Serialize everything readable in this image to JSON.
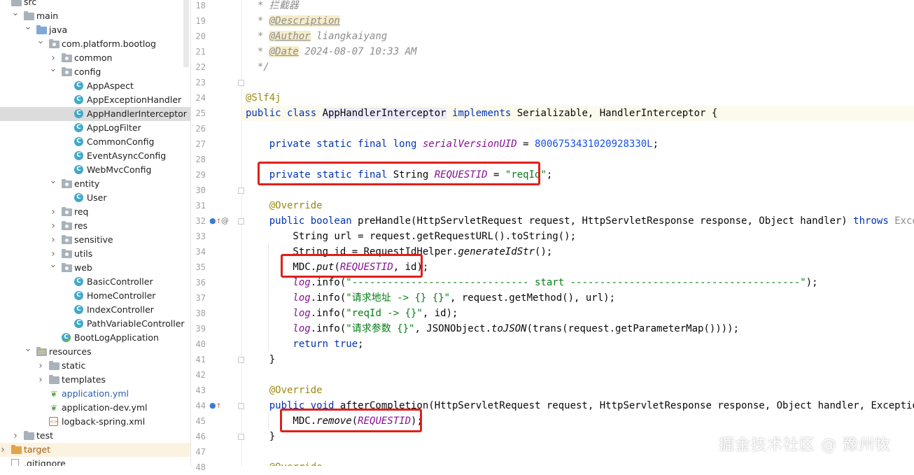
{
  "tree": {
    "items": [
      {
        "label": "src",
        "depth": 0,
        "arrow": "",
        "icon": "folder-icon"
      },
      {
        "label": "main",
        "depth": 1,
        "arrow": "down",
        "icon": "folder-icon"
      },
      {
        "label": "java",
        "depth": 2,
        "arrow": "down",
        "icon": "source-folder-icon"
      },
      {
        "label": "com.platform.bootlog",
        "depth": 3,
        "arrow": "down",
        "icon": "package-icon"
      },
      {
        "label": "common",
        "depth": 4,
        "arrow": "right",
        "icon": "package-icon"
      },
      {
        "label": "config",
        "depth": 4,
        "arrow": "down",
        "icon": "package-icon"
      },
      {
        "label": "AppAspect",
        "depth": 5,
        "arrow": "",
        "icon": "class-icon"
      },
      {
        "label": "AppExceptionHandler",
        "depth": 5,
        "arrow": "",
        "icon": "class-icon"
      },
      {
        "label": "AppHandlerInterceptor",
        "depth": 5,
        "arrow": "",
        "icon": "class-icon",
        "selected": true
      },
      {
        "label": "AppLogFilter",
        "depth": 5,
        "arrow": "",
        "icon": "class-icon"
      },
      {
        "label": "CommonConfig",
        "depth": 5,
        "arrow": "",
        "icon": "class-icon"
      },
      {
        "label": "EventAsyncConfig",
        "depth": 5,
        "arrow": "",
        "icon": "class-icon"
      },
      {
        "label": "WebMvcConfig",
        "depth": 5,
        "arrow": "",
        "icon": "class-icon"
      },
      {
        "label": "entity",
        "depth": 4,
        "arrow": "down",
        "icon": "package-icon"
      },
      {
        "label": "User",
        "depth": 5,
        "arrow": "",
        "icon": "class-icon"
      },
      {
        "label": "req",
        "depth": 4,
        "arrow": "right",
        "icon": "package-icon"
      },
      {
        "label": "res",
        "depth": 4,
        "arrow": "right",
        "icon": "package-icon"
      },
      {
        "label": "sensitive",
        "depth": 4,
        "arrow": "right",
        "icon": "package-icon"
      },
      {
        "label": "utils",
        "depth": 4,
        "arrow": "right",
        "icon": "package-icon"
      },
      {
        "label": "web",
        "depth": 4,
        "arrow": "down",
        "icon": "package-icon"
      },
      {
        "label": "BasicController",
        "depth": 5,
        "arrow": "",
        "icon": "class-icon"
      },
      {
        "label": "HomeController",
        "depth": 5,
        "arrow": "",
        "icon": "class-icon"
      },
      {
        "label": "IndexController",
        "depth": 5,
        "arrow": "",
        "icon": "class-icon"
      },
      {
        "label": "PathVariableController",
        "depth": 5,
        "arrow": "",
        "icon": "class-icon"
      },
      {
        "label": "BootLogApplication",
        "depth": 4,
        "arrow": "",
        "icon": "spring-class-icon"
      },
      {
        "label": "resources",
        "depth": 2,
        "arrow": "down",
        "icon": "resources-folder-icon"
      },
      {
        "label": "static",
        "depth": 3,
        "arrow": "right",
        "icon": "folder-icon"
      },
      {
        "label": "templates",
        "depth": 3,
        "arrow": "right",
        "icon": "folder-icon"
      },
      {
        "label": "application.yml",
        "depth": 3,
        "arrow": "",
        "icon": "yml-icon",
        "color": "blue"
      },
      {
        "label": "application-dev.yml",
        "depth": 3,
        "arrow": "",
        "icon": "yml-icon"
      },
      {
        "label": "logback-spring.xml",
        "depth": 3,
        "arrow": "",
        "icon": "xml-icon"
      },
      {
        "label": "test",
        "depth": 1,
        "arrow": "right",
        "icon": "folder-icon"
      },
      {
        "label": "target",
        "depth": 0,
        "arrow": "right",
        "icon": "excluded-folder-icon",
        "color": "orange",
        "excluded": true
      },
      {
        "label": ".gitignore",
        "depth": 0,
        "arrow": "",
        "icon": "file-icon"
      }
    ]
  },
  "editor": {
    "lines": [
      {
        "n": "18",
        "tokens": [
          [
            "cmt",
            "  * 拦截器"
          ]
        ]
      },
      {
        "n": "19",
        "tokens": [
          [
            "cmt",
            "  * "
          ],
          [
            "tag",
            "@Description"
          ]
        ]
      },
      {
        "n": "20",
        "tokens": [
          [
            "cmt",
            "  * "
          ],
          [
            "tag",
            "@Author"
          ],
          [
            "cmt",
            " liangkaiyang"
          ]
        ]
      },
      {
        "n": "21",
        "tokens": [
          [
            "cmt",
            "  * "
          ],
          [
            "tag",
            "@Date"
          ],
          [
            "cmt",
            " 2024-08-07 10:33 AM"
          ]
        ]
      },
      {
        "n": "22",
        "tokens": [
          [
            "cmt",
            "  */"
          ]
        ]
      },
      {
        "n": "23",
        "tokens": []
      },
      {
        "n": "24",
        "tokens": [
          [
            "ann",
            "@Slf4j"
          ]
        ]
      },
      {
        "n": "25",
        "current": true,
        "tokens": [
          [
            "kw",
            "public class "
          ],
          [
            "cls-hl",
            "AppHandlerInterceptor"
          ],
          [
            "kw",
            " implements "
          ],
          [
            "",
            "Serializable, HandlerInterceptor {"
          ]
        ]
      },
      {
        "n": "26",
        "tokens": []
      },
      {
        "n": "27",
        "tokens": [
          [
            "kw",
            "    private static final long "
          ],
          [
            "const",
            "serialVersionUID"
          ],
          [
            "",
            " = "
          ],
          [
            "num",
            "8006753431020928330L"
          ],
          [
            "",
            ";"
          ]
        ]
      },
      {
        "n": "28",
        "tokens": []
      },
      {
        "n": "29",
        "tokens": [
          [
            "kw",
            "    private static final "
          ],
          [
            "",
            "String "
          ],
          [
            "const",
            "REQUESTID"
          ],
          [
            "",
            " = "
          ],
          [
            "str",
            "\"reqId\""
          ],
          [
            "",
            ";"
          ]
        ]
      },
      {
        "n": "30",
        "tokens": []
      },
      {
        "n": "31",
        "tokens": [
          [
            "ann",
            "    @Override"
          ]
        ]
      },
      {
        "n": "32",
        "tokens": [
          [
            "kw",
            "    public boolean "
          ],
          [
            "",
            "preHandle(HttpServletRequest request, HttpServletResponse response, Object handler) "
          ],
          [
            "kw",
            "throws "
          ],
          [
            "cmt2",
            "Exception"
          ]
        ]
      },
      {
        "n": "33",
        "tokens": [
          [
            "",
            "        String url = request.getRequestURL().toString();"
          ]
        ]
      },
      {
        "n": "34",
        "tokens": [
          [
            "",
            "        String id = RequestIdHelper."
          ],
          [
            "static",
            "generateIdStr"
          ],
          [
            "",
            "();"
          ]
        ]
      },
      {
        "n": "35",
        "tokens": [
          [
            "",
            "        MDC."
          ],
          [
            "static",
            "put"
          ],
          [
            "",
            "("
          ],
          [
            "const",
            "REQUESTID"
          ],
          [
            "",
            ", id);"
          ]
        ]
      },
      {
        "n": "36",
        "tokens": [
          [
            "log",
            "        log"
          ],
          [
            "",
            ".info("
          ],
          [
            "str",
            "\"------------------------------ start ---------------------------------------\""
          ],
          [
            "",
            ");"
          ]
        ]
      },
      {
        "n": "37",
        "tokens": [
          [
            "log",
            "        log"
          ],
          [
            "",
            ".info("
          ],
          [
            "str",
            "\"请求地址 -> {} {}\""
          ],
          [
            "",
            ", request.getMethod(), url);"
          ]
        ]
      },
      {
        "n": "38",
        "tokens": [
          [
            "log",
            "        log"
          ],
          [
            "",
            ".info("
          ],
          [
            "str",
            "\"reqId -> {}\""
          ],
          [
            "",
            ", id);"
          ]
        ]
      },
      {
        "n": "39",
        "tokens": [
          [
            "log",
            "        log"
          ],
          [
            "",
            ".info("
          ],
          [
            "str",
            "\"请求参数 {}\""
          ],
          [
            "",
            ", JSONObject."
          ],
          [
            "static",
            "toJSON"
          ],
          [
            "",
            "(trans(request.getParameterMap())));"
          ]
        ]
      },
      {
        "n": "40",
        "tokens": [
          [
            "kw",
            "        return true"
          ],
          [
            "",
            ";"
          ]
        ]
      },
      {
        "n": "41",
        "tokens": [
          [
            "",
            "    }"
          ]
        ]
      },
      {
        "n": "42",
        "tokens": []
      },
      {
        "n": "43",
        "tokens": [
          [
            "ann",
            "    @Override"
          ]
        ]
      },
      {
        "n": "44",
        "tokens": [
          [
            "kw",
            "    public void "
          ],
          [
            "",
            "afterCompletion(HttpServletRequest request, HttpServletResponse response, Object handler, Exception ex)"
          ]
        ]
      },
      {
        "n": "45",
        "tokens": [
          [
            "",
            "        MDC."
          ],
          [
            "static",
            "remove"
          ],
          [
            "",
            "("
          ],
          [
            "const",
            "REQUESTID"
          ],
          [
            "",
            ");"
          ]
        ]
      },
      {
        "n": "46",
        "tokens": [
          [
            "",
            "    }"
          ]
        ]
      },
      {
        "n": "47",
        "tokens": []
      },
      {
        "n": "48",
        "tokens": [
          [
            "ann",
            "    @Override"
          ]
        ]
      }
    ]
  },
  "watermark": "掘金技术社区 @ 豫州牧"
}
